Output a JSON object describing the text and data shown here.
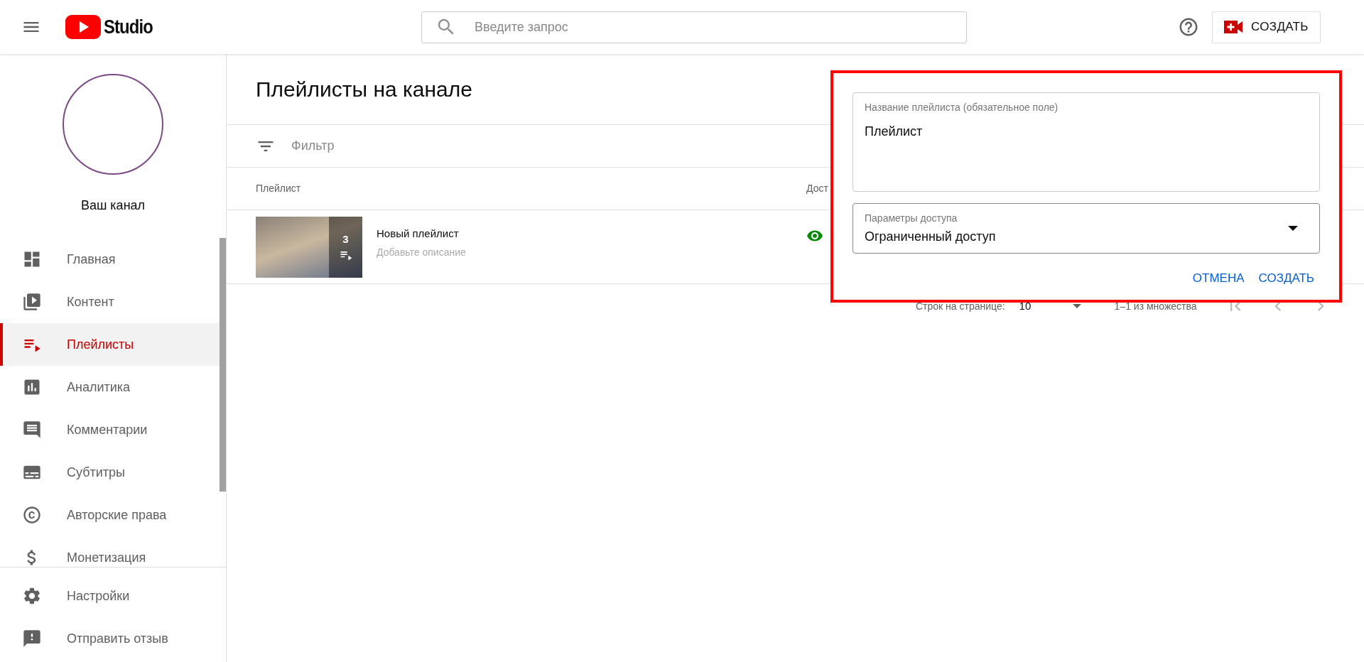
{
  "header": {
    "logo_text": "Studio",
    "search": {
      "placeholder": "Введите запрос"
    },
    "create_button": "СОЗДАТЬ"
  },
  "sidebar": {
    "channel_name": "Ваш канал",
    "items": [
      {
        "label": "Главная",
        "selected": false
      },
      {
        "label": "Контент",
        "selected": false
      },
      {
        "label": "Плейлисты",
        "selected": true
      },
      {
        "label": "Аналитика",
        "selected": false
      },
      {
        "label": "Комментарии",
        "selected": false
      },
      {
        "label": "Субтитры",
        "selected": false
      },
      {
        "label": "Авторские права",
        "selected": false
      },
      {
        "label": "Монетизация",
        "selected": false
      }
    ],
    "footer_items": [
      {
        "label": "Настройки"
      },
      {
        "label": "Отправить отзыв"
      }
    ]
  },
  "page": {
    "title": "Плейлисты на канале",
    "filter": {
      "placeholder": "Фильтр"
    },
    "columns": [
      "Плейлист",
      "Дост"
    ],
    "rows": [
      {
        "title": "Новый плейлист",
        "description": "Добавьте описание",
        "video_count": "3"
      }
    ],
    "pagination": {
      "rows_label": "Строк на странице:",
      "rows_value": "10",
      "range": "1–1 из множества"
    }
  },
  "dialog": {
    "name_field": {
      "label": "Название плейлиста (обязательное поле)",
      "value": "Плейлист"
    },
    "access_field": {
      "label": "Параметры доступа",
      "value": "Ограниченный доступ"
    },
    "buttons": [
      "ОТМЕНА",
      "СОЗДАТЬ"
    ]
  }
}
